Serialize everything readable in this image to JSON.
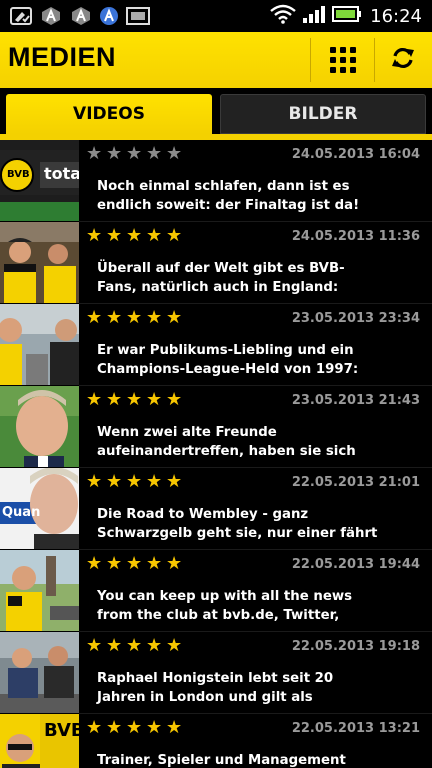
{
  "status": {
    "time": "16:24",
    "icons": [
      "wrench-check-icon",
      "bvb-app-icon",
      "bvb-app-icon",
      "browser-icon",
      "screenshot-icon",
      "wifi-icon",
      "signal-icon",
      "battery-icon"
    ]
  },
  "header": {
    "title": "MEDIEN",
    "grid_icon": "grid-icon",
    "refresh_icon": "refresh-icon",
    "accent": "#F9DC00"
  },
  "tabs": [
    {
      "label": "VIDEOS",
      "active": true
    },
    {
      "label": "BILDER",
      "active": false
    }
  ],
  "videos": [
    {
      "rating": 0,
      "date": "24.05.2013 16:04",
      "line1": "Noch einmal schlafen, dann ist es",
      "line2": "endlich soweit: der Finaltag ist da!"
    },
    {
      "rating": 5,
      "date": "24.05.2013 11:36",
      "line1": "Überall auf der Welt gibt es BVB-",
      "line2": "Fans, natürlich auch in England:"
    },
    {
      "rating": 5,
      "date": "23.05.2013 23:34",
      "line1": "Er war Publikums-Liebling und ein",
      "line2": "Champions-League-Held von 1997:"
    },
    {
      "rating": 5,
      "date": "23.05.2013 21:43",
      "line1": "Wenn zwei alte Freunde",
      "line2": "aufeinandertreffen, haben sie sich"
    },
    {
      "rating": 5,
      "date": "22.05.2013 21:01",
      "line1": "Die Road to Wembley - ganz",
      "line2": "Schwarzgelb geht sie, nur einer fährt"
    },
    {
      "rating": 5,
      "date": "22.05.2013 19:44",
      "line1": "You can keep up with all the news",
      "line2": "from the club at bvb.de, Twitter,"
    },
    {
      "rating": 5,
      "date": "22.05.2013 19:18",
      "line1": "Raphael Honigstein lebt seit 20",
      "line2": "Jahren in London und gilt als"
    },
    {
      "rating": 5,
      "date": "22.05.2013 13:21",
      "line1": "Trainer, Spieler und Management",
      "line2": ""
    }
  ],
  "thumbnails": [
    {
      "logo": "BVB",
      "caption": "total!"
    },
    {
      "logo": "",
      "caption": ""
    },
    {
      "logo": "",
      "caption": ""
    },
    {
      "logo": "",
      "caption": ""
    },
    {
      "logo": "",
      "caption": "Quan"
    },
    {
      "logo": "",
      "caption": ""
    },
    {
      "logo": "",
      "caption": ""
    },
    {
      "logo": "BVB",
      "caption": ""
    }
  ]
}
